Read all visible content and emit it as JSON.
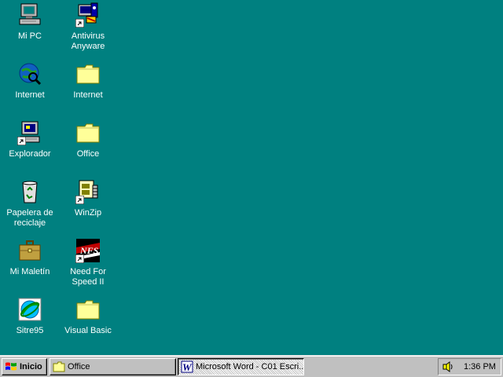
{
  "desktop": {
    "background_color": "#008080",
    "icons": [
      {
        "label": "Mi PC",
        "icon": "my-computer-icon"
      },
      {
        "label": "Antivirus\nAnyware",
        "icon": "antivirus-icon"
      },
      {
        "label": "Internet",
        "icon": "internet-explorer-icon"
      },
      {
        "label": "Internet",
        "icon": "folder-icon"
      },
      {
        "label": "Explorador",
        "icon": "explorer-icon"
      },
      {
        "label": "Office",
        "icon": "folder-icon"
      },
      {
        "label": "Papelera de\nreciclaje",
        "icon": "recycle-bin-icon"
      },
      {
        "label": "WinZip",
        "icon": "winzip-icon"
      },
      {
        "label": "Mi Maletín",
        "icon": "briefcase-icon"
      },
      {
        "label": "Need For\nSpeed II",
        "icon": "need-for-speed-icon"
      },
      {
        "label": "Sitre95",
        "icon": "sitre95-icon"
      },
      {
        "label": "Visual Basic",
        "icon": "folder-icon"
      }
    ]
  },
  "taskbar": {
    "start_label": "Inicio",
    "tasks": [
      {
        "label": "Office",
        "icon": "folder-icon",
        "active": false
      },
      {
        "label": "Microsoft Word - C01 Escri...",
        "icon": "word-icon",
        "active": true
      }
    ],
    "tray": {
      "clock": "1:36 PM",
      "icons": [
        "volume-icon"
      ]
    }
  }
}
